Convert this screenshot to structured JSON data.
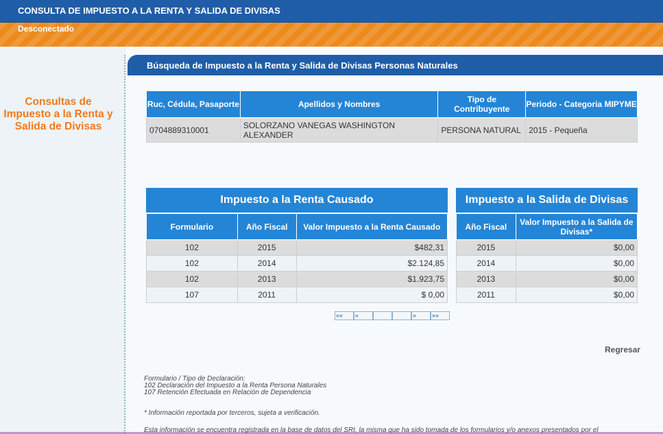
{
  "header": {
    "title": "CONSULTA DE IMPUESTO A LA RENTA Y SALIDA DE DIVISAS",
    "status": "Desconectado"
  },
  "sidebar": {
    "heading_line1": "Consultas de",
    "heading_line2": "Impuesto a la Renta y",
    "heading_line3": "Salida de Divisas"
  },
  "section": {
    "title": "Búsqueda de Impuesto a la Renta y Salida de Divisas Personas Naturales"
  },
  "taxpayer": {
    "headers": [
      "Ruc, Cédula, Pasaporte",
      "Apellidos y Nombres",
      "Tipo de Contribuyente",
      "Periodo - Categoria MIPYME"
    ],
    "id": "0704889310001",
    "name": "SOLORZANO VANEGAS WASHINGTON ALEXANDER",
    "type": "PERSONA NATURAL",
    "period": "2015 - Pequeña"
  },
  "renta": {
    "title": "Impuesto a la Renta Causado",
    "headers": [
      "Formulario",
      "Año Fiscal",
      "Valor Impuesto a la Renta Causado"
    ],
    "rows": [
      {
        "form": "102",
        "year": "2015",
        "value": "$482,31"
      },
      {
        "form": "102",
        "year": "2014",
        "value": "$2.124,85"
      },
      {
        "form": "102",
        "year": "2013",
        "value": "$1.923,75"
      },
      {
        "form": "107",
        "year": "2011",
        "value": "$ 0,00"
      }
    ]
  },
  "isd": {
    "title": "Impuesto a la Salida de Divisas",
    "headers": [
      "Año Fiscal",
      "Valor Impuesto a la Salida de Divisas*"
    ],
    "rows": [
      {
        "year": "2015",
        "value": "$0,00"
      },
      {
        "year": "2014",
        "value": "$0,00"
      },
      {
        "year": "2013",
        "value": "$0,00"
      },
      {
        "year": "2011",
        "value": "$0,00"
      }
    ]
  },
  "pager": {
    "first": "««",
    "prev": "«",
    "next": "»",
    "last": "»»"
  },
  "actions": {
    "back": "Regresar"
  },
  "notes": {
    "line1": "Formulario / Tipo de Declaración:",
    "line2": "102 Declaración del Impuesto a la Renta Persona Naturales",
    "line3": "107 Retención Efectuada en Relación de Dependencia",
    "star": "* Información reportada por terceros, sujeta a verificación.",
    "bottom": "Esta información se encuentra registrada en la base de datos del SRI, la misma que ha sido tomada de los formularios y/o anexos presentados por el"
  },
  "colors": {
    "header_blue": "#1f5da8",
    "table_blue": "#2485d6",
    "orange": "#ec8a1e",
    "heading_orange": "#ee7a1e"
  }
}
